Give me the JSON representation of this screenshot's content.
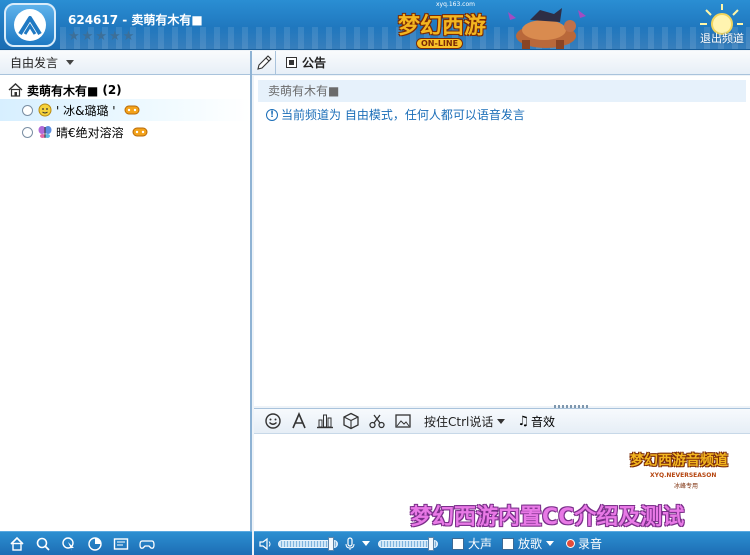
{
  "header": {
    "title": "624617 - 卖萌有木有■",
    "stars": [
      "★",
      "★",
      "★",
      "★",
      "★"
    ],
    "game_logo": "梦幻西游",
    "game_logo_sub": "ON-LINE",
    "game_logo_url": "xyq.163.com",
    "exit_label": "退出频道"
  },
  "left": {
    "mode_label": "自由发言",
    "channel_name": "卖萌有木有■",
    "channel_count": "(2)",
    "members": [
      {
        "name": "' 冰&璐璐 '"
      },
      {
        "name": "晴€绝对溶溶"
      }
    ]
  },
  "right": {
    "notice_tab": "公告",
    "notice_text": "卖萌有木有■",
    "system_message": "当前频道为 自由模式，任何人都可以语音发言"
  },
  "input_toolbar": {
    "ptt_label": "按住Ctrl说话",
    "sfx_label": "音效"
  },
  "input_area": {
    "corner_logo_title": "梦幻西游音频道",
    "corner_logo_sub": "XYQ.NEVERSEASON",
    "corner_logo_tag": "冰峰专用",
    "watermark": "梦幻西游内置CC介绍及测试"
  },
  "bottom_toolbar": {
    "loud_label": "大声",
    "play_label": "放歌",
    "record_label": "录音",
    "speaker_volume": 0.95,
    "mic_volume": 0.95
  },
  "colors": {
    "header_blue": "#1f76bd",
    "system_message": "#1b6eb8",
    "watermark_pink": "#e879e6"
  }
}
